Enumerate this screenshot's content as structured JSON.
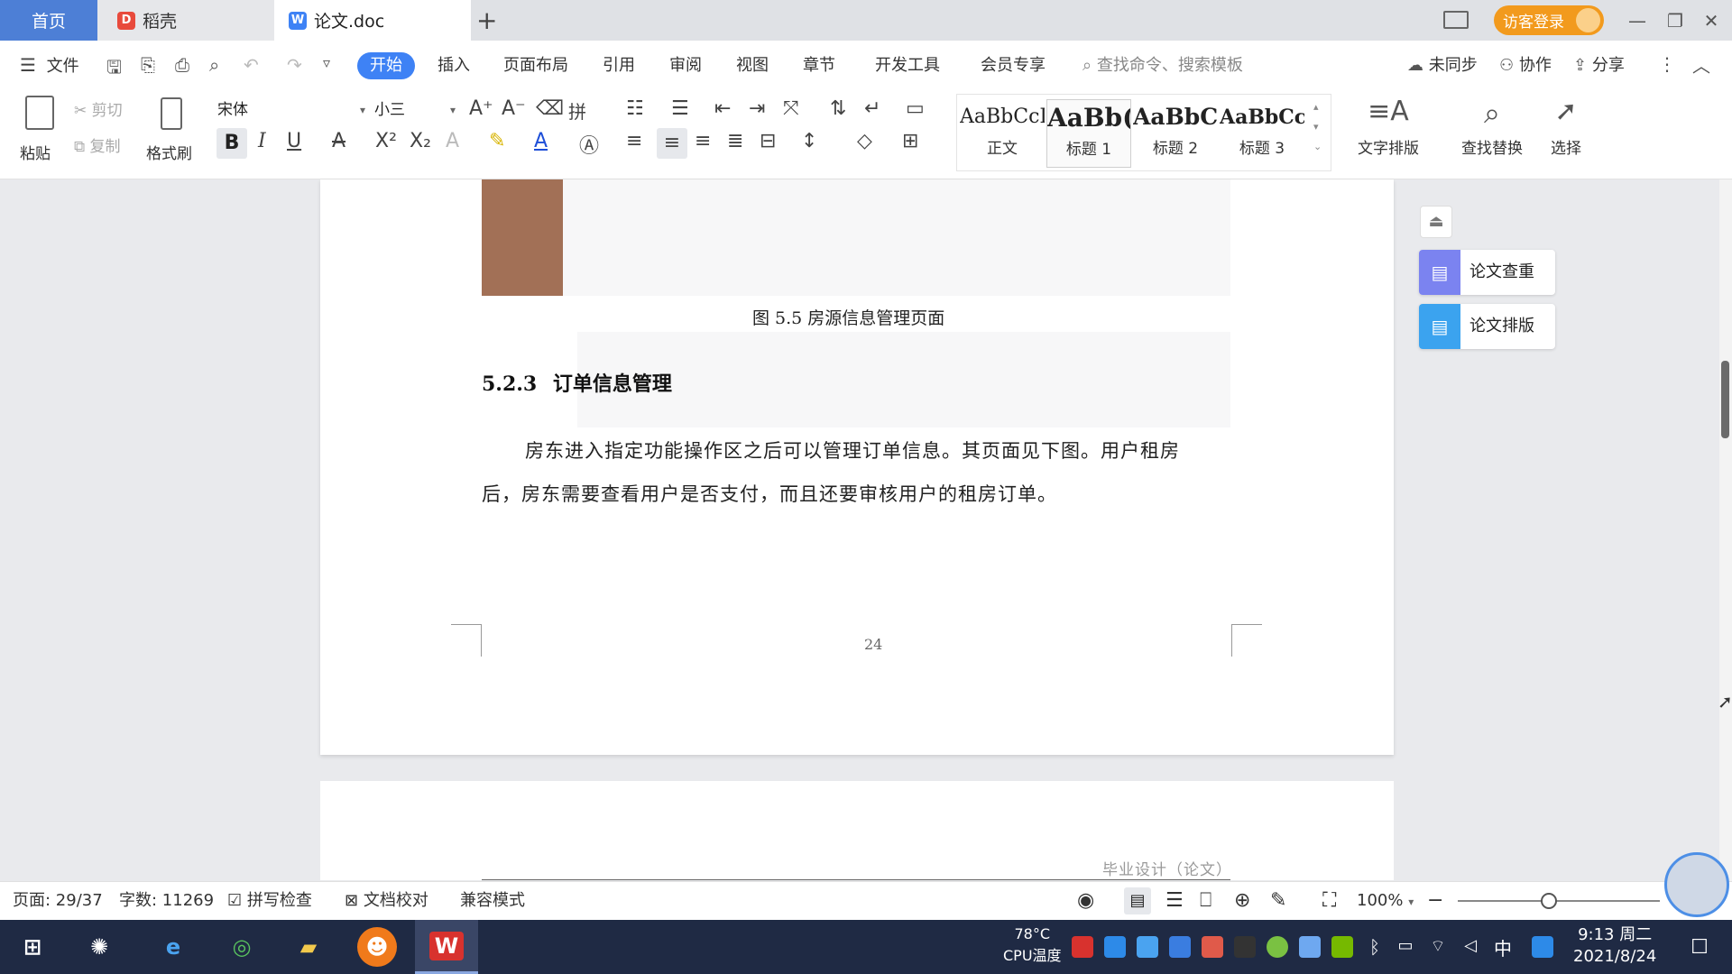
{
  "titlebar": {
    "tabs": [
      {
        "label": "首页"
      },
      {
        "label": "稻壳"
      },
      {
        "label": "论文.doc"
      }
    ],
    "new_tab_symbol": "+",
    "login_label": "访客登录"
  },
  "menubar": {
    "file_label": "文件",
    "items": [
      "开始",
      "插入",
      "页面布局",
      "引用",
      "审阅",
      "视图",
      "章节",
      "开发工具",
      "会员专享"
    ],
    "search_placeholder": "查找命令、搜索模板",
    "sync_label": "未同步",
    "collab_label": "协作",
    "share_label": "分享"
  },
  "ribbon": {
    "paste_label": "粘贴",
    "cut_label": "剪切",
    "copy_label": "复制",
    "format_painter_label": "格式刷",
    "font_name": "宋体",
    "font_size": "小三",
    "styles": [
      {
        "sample": "AaBbCcI",
        "label": "正文"
      },
      {
        "sample": "AaBb(",
        "label": "标题 1"
      },
      {
        "sample": "AaBbC",
        "label": "标题 2"
      },
      {
        "sample": "AaBbCcl",
        "label": "标题 3"
      }
    ],
    "text_layout_label": "文字排版",
    "find_replace_label": "查找替换",
    "select_label": "选择"
  },
  "document": {
    "caption": "图 5.5  房源信息管理页面",
    "heading_number": "5.2.3",
    "heading_text": "订单信息管理",
    "para_line1": "房东进入指定功能操作区之后可以管理订单信息。其页面见下图。用户租房",
    "para_line2": "后，房东需要查看用户是否支付，而且还要审核用户的租房订单。",
    "page_number": "24",
    "next_page_header": "毕业设计（论文）"
  },
  "side_panel": {
    "items": [
      {
        "label": "论文查重"
      },
      {
        "label": "论文排版"
      }
    ]
  },
  "statusbar": {
    "page": "页面: 29/37",
    "words": "字数: 11269",
    "spell_check": "拼写检查",
    "doc_check": "文档校对",
    "compat_mode": "兼容模式",
    "zoom": "100%"
  },
  "taskbar": {
    "cpu_temp": "78°C",
    "cpu_label": "CPU温度",
    "ime": "中",
    "time": "9:13 周二",
    "date": "2021/8/24"
  },
  "colors": {
    "accent": "#3e82f5",
    "login": "#f29a1d",
    "figure_block": "#a27056",
    "taskbar": "#1f2a44"
  }
}
